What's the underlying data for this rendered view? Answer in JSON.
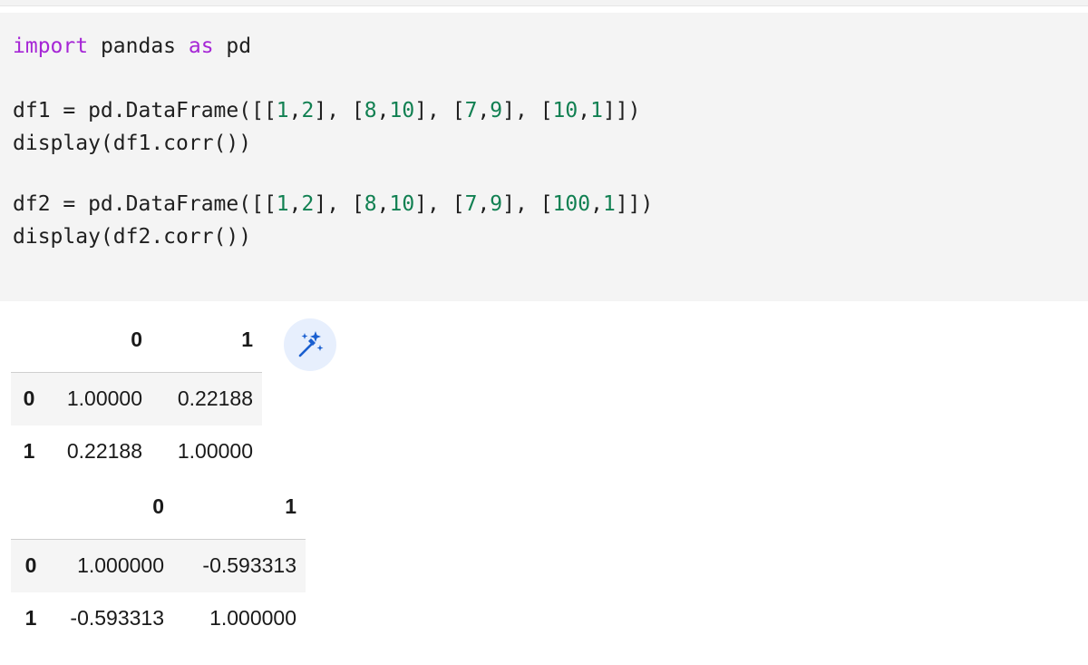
{
  "code": {
    "kw_import": "import",
    "mod_pandas": " pandas ",
    "kw_as": "as",
    "alias_pd": " pd",
    "df1_prefix": "df1 = pd.DataFrame([[",
    "df1_n1": "1",
    "df1_n2": "2",
    "df1_n3": "8",
    "df1_n4": "10",
    "df1_n5": "7",
    "df1_n6": "9",
    "df1_n7": "10",
    "df1_n8": "1",
    "display1": "display(df1.corr())",
    "df2_prefix": "df2 = pd.DataFrame([[",
    "df2_n1": "1",
    "df2_n2": "2",
    "df2_n3": "8",
    "df2_n4": "10",
    "df2_n5": "7",
    "df2_n6": "9",
    "df2_n7": "100",
    "df2_n8": "1",
    "display2": "display(df2.corr())",
    "sep_a": ",",
    "sep_b": "], [",
    "suffix": "]])"
  },
  "output1": {
    "columns": [
      "0",
      "1"
    ],
    "rows": [
      {
        "index": "0",
        "values": [
          "1.00000",
          "0.22188"
        ]
      },
      {
        "index": "1",
        "values": [
          "0.22188",
          "1.00000"
        ]
      }
    ]
  },
  "output2": {
    "columns": [
      "0",
      "1"
    ],
    "rows": [
      {
        "index": "0",
        "values": [
          "1.000000",
          "-0.593313"
        ]
      },
      {
        "index": "1",
        "values": [
          "-0.593313",
          "1.000000"
        ]
      }
    ]
  },
  "icons": {
    "magic": "magic-wand-sparkle-icon",
    "accent": "#1a5fd0",
    "button_bg": "#e7effd"
  },
  "colors": {
    "keyword": "#a626d6",
    "number": "#118052",
    "code_bg": "#f4f4f4"
  }
}
